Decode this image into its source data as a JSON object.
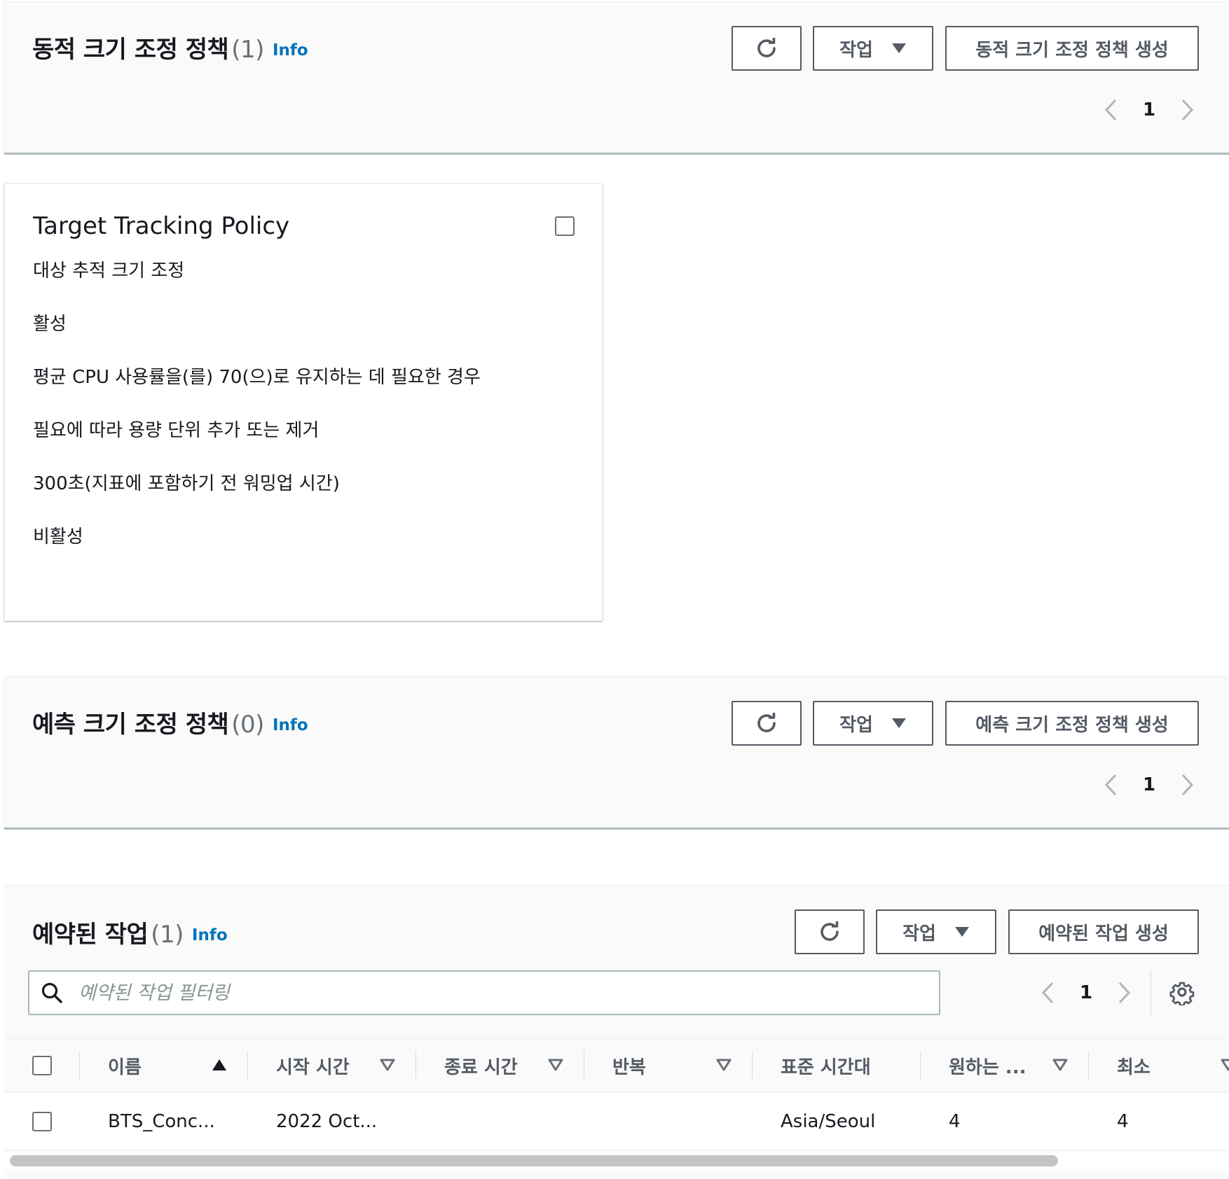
{
  "dynamic": {
    "title": "동적 크기 조정 정책",
    "count": "(1)",
    "info": "Info",
    "actions_label": "작업",
    "create_label": "동적 크기 조정 정책 생성",
    "page": "1"
  },
  "policy_card": {
    "name": "Target Tracking Policy",
    "lines": [
      "대상 추적 크기 조정",
      "활성",
      "평균 CPU 사용률을(를) 70(으)로 유지하는 데 필요한 경우",
      "필요에 따라 용량 단위 추가 또는 제거",
      "300초(지표에 포함하기 전 워밍업 시간)",
      "비활성"
    ]
  },
  "predictive": {
    "title": "예측 크기 조정 정책",
    "count": "(0)",
    "info": "Info",
    "actions_label": "작업",
    "create_label": "예측 크기 조정 정책 생성",
    "page": "1"
  },
  "scheduled": {
    "title": "예약된 작업",
    "count": "(1)",
    "info": "Info",
    "actions_label": "작업",
    "create_label": "예약된 작업 생성",
    "page": "1",
    "search_placeholder": "예약된 작업 필터링",
    "columns": [
      "이름",
      "시작 시간",
      "종료 시간",
      "반복",
      "표준 시간대",
      "원하는 ...",
      "최소"
    ],
    "rows": [
      [
        "BTS_Conc...",
        "2022 Oct...",
        "",
        "",
        "Asia/Seoul",
        "4",
        "4"
      ]
    ]
  },
  "colors": {
    "link": "#0073bb",
    "button_border": "#545b64",
    "text": "#16191f",
    "muted": "#687078"
  },
  "icons": [
    "refresh-icon",
    "caret-down-icon",
    "chevron-left-icon",
    "chevron-right-icon",
    "search-icon",
    "gear-icon",
    "sort-ascending-icon",
    "sort-descending-icon"
  ]
}
